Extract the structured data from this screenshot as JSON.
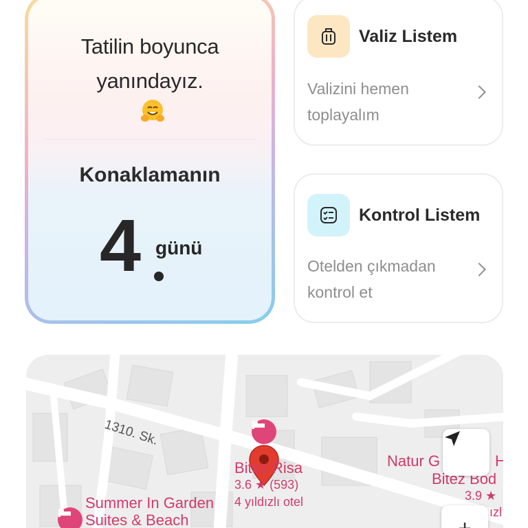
{
  "stay": {
    "message_line1": "Tatilin boyunca",
    "message_line2": "yanındayız.",
    "emoji": "hugging-face",
    "label": "Konaklamanın",
    "day_number": "4",
    "day_suffix": "günü"
  },
  "luggage_card": {
    "title": "Valiz Listem",
    "desc_line1": "Valizini hemen",
    "desc_line2": "toplayalım",
    "icon": "suitcase-icon"
  },
  "check_card": {
    "title": "Kontrol Listem",
    "desc_line1": "Otelden çıkmadan",
    "desc_line2": "kontrol et",
    "icon": "checklist-icon"
  },
  "map": {
    "street": "1310. Sk.",
    "hotel_main_name": "Bitez Risa",
    "hotel_main_rating": "3.6 ★ (593)",
    "hotel_main_type": "4 yıldızlı otel",
    "hotel_left_line1": "Summer In Garden",
    "hotel_left_line2": "Suites & Beach",
    "hotel_right_line1": "Natur G",
    "hotel_right_line1b": "H",
    "hotel_right_line2": "Bitez Bod",
    "hotel_right_rating": "3.9 ★",
    "hotel_right_type": "ızl",
    "zoom_in": "+"
  },
  "colors": {
    "accent_pink": "#e0457a",
    "pin_red": "#d93025",
    "luggage_icon_bg": "#fde7c3",
    "check_icon_bg": "#d3f3fb"
  }
}
